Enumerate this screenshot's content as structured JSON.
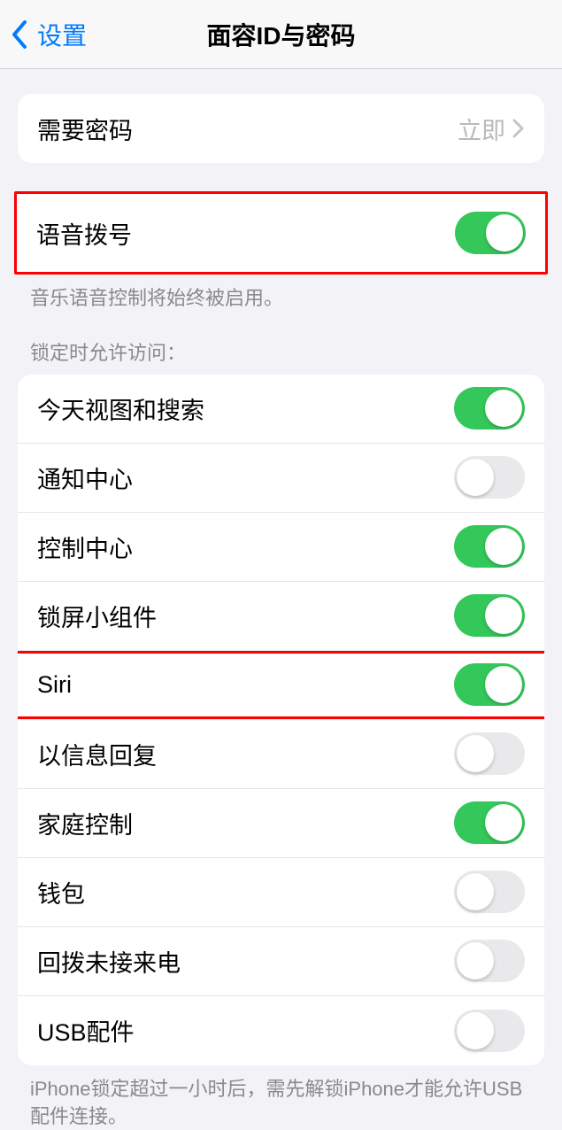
{
  "nav": {
    "back_label": "设置",
    "title": "面容ID与密码"
  },
  "require_passcode": {
    "label": "需要密码",
    "value": "立即"
  },
  "voice_dial": {
    "label": "语音拨号",
    "on": true,
    "footer": "音乐语音控制将始终被启用。"
  },
  "lock_access": {
    "header": "锁定时允许访问：",
    "items": [
      {
        "label": "今天视图和搜索",
        "on": true,
        "highlight": false
      },
      {
        "label": "通知中心",
        "on": false,
        "highlight": false
      },
      {
        "label": "控制中心",
        "on": true,
        "highlight": false
      },
      {
        "label": "锁屏小组件",
        "on": true,
        "highlight": false
      },
      {
        "label": "Siri",
        "on": true,
        "highlight": true
      },
      {
        "label": "以信息回复",
        "on": false,
        "highlight": false
      },
      {
        "label": "家庭控制",
        "on": true,
        "highlight": false
      },
      {
        "label": "钱包",
        "on": false,
        "highlight": false
      },
      {
        "label": "回拨未接来电",
        "on": false,
        "highlight": false
      },
      {
        "label": "USB配件",
        "on": false,
        "highlight": false
      }
    ],
    "footer": "iPhone锁定超过一小时后，需先解锁iPhone才能允许USB配件连接。"
  }
}
